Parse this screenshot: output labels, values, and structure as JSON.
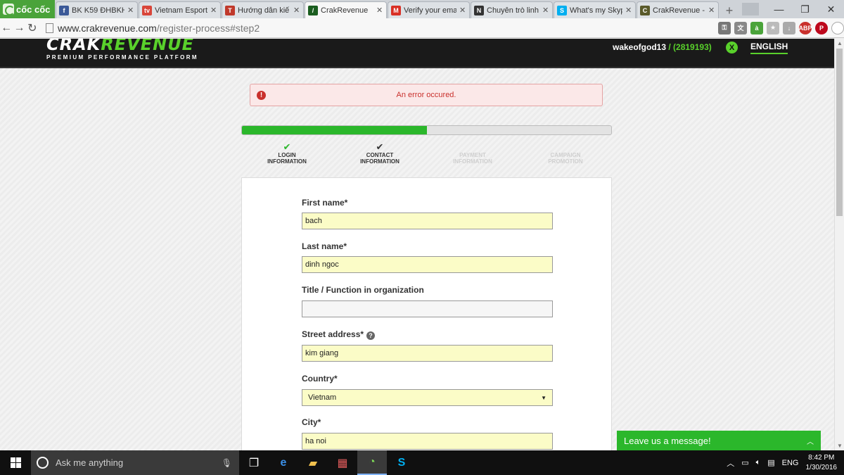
{
  "browser": {
    "brand": "cốc cốc",
    "tabs": [
      {
        "title": "BK K59 ĐHBKH",
        "color": "#3b5998",
        "glyph": "f",
        "active": false
      },
      {
        "title": "Vietnam Esport",
        "color": "#d9463a",
        "glyph": "tv",
        "active": false
      },
      {
        "title": "Hướng dẫn kiế",
        "color": "#c0392b",
        "glyph": "T",
        "active": false
      },
      {
        "title": "CrakRevenue",
        "color": "#1b5e20",
        "glyph": "/",
        "active": true
      },
      {
        "title": "Verify your ema",
        "color": "#d93025",
        "glyph": "M",
        "active": false
      },
      {
        "title": "Chuyên trò linh",
        "color": "#333333",
        "glyph": "N",
        "active": false
      },
      {
        "title": "What's my Skyp",
        "color": "#00aff0",
        "glyph": "S",
        "active": false
      },
      {
        "title": "CrakRevenue -",
        "color": "#5a5a2a",
        "glyph": "C",
        "active": false
      }
    ],
    "close_glyph": "✕",
    "new_tab_glyph": "+",
    "url_host": "www.crakrevenue.com",
    "url_path": "/register-process#step2"
  },
  "site": {
    "logo_part1": "CRAK",
    "logo_part2": "REVENUE",
    "tagline": "PREMIUM PERFORMANCE PLATFORM",
    "username": "wakeofgod13",
    "user_id": " / (2819193)",
    "logout_glyph": "X",
    "language": "ENGLISH",
    "error_message": "An error occured.",
    "progress_fraction": 0.5,
    "steps": [
      {
        "line1": "LOGIN",
        "line2": "INFORMATION",
        "state": "done"
      },
      {
        "line1": "CONTACT",
        "line2": "INFORMATION",
        "state": "current"
      },
      {
        "line1": "PAYMENT",
        "line2": "INFORMATION",
        "state": "pending"
      },
      {
        "line1": "CAMPAIGN",
        "line2": "PROMOTION",
        "state": "pending"
      }
    ],
    "form": {
      "first_name_label": "First name*",
      "first_name_value": "bach",
      "last_name_label": "Last name*",
      "last_name_value": "dinh ngoc",
      "title_label": "Title / Function in organization",
      "title_value": "",
      "street_label": "Street address*",
      "street_value": "kim giang",
      "country_label": "Country*",
      "country_value": "Vietnam",
      "city_label": "City*",
      "city_value": "ha noi"
    },
    "chat_label": "Leave us a message!"
  },
  "taskbar": {
    "search_placeholder": "Ask me anything",
    "language": "ENG",
    "time": "8:42 PM",
    "date": "1/30/2016"
  },
  "colors": {
    "accent_green": "#59d12b",
    "progress_green": "#2bb72b",
    "error_red": "#c9302c",
    "input_yellow": "#fbfcc7"
  }
}
